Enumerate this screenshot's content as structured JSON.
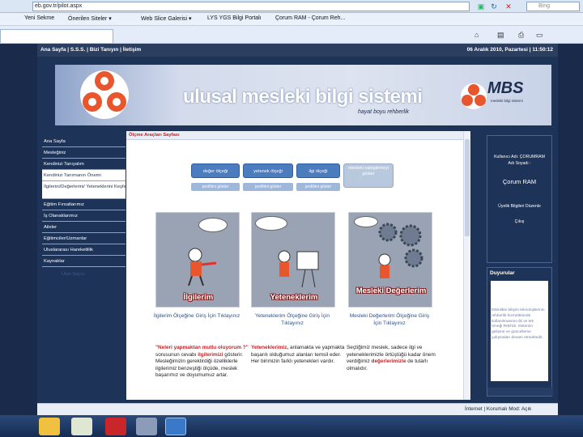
{
  "browser": {
    "url": "eb.gov.tr/pilot.aspx",
    "search_placeholder": "Bing",
    "favorites": [
      "Yeni Sekme",
      "Önerilen Siteler ▾",
      "Web Slice Galerisi ▾",
      "LYS YGS Bilgi Portalı",
      "Çorum RAM - Çorum Reh..."
    ]
  },
  "header": {
    "links": "Ana Sayfa | S.S.S. | Bizi Tanıyın | İletişim",
    "date": "06 Aralık 2010, Pazartesi | 11:50:12"
  },
  "banner": {
    "title": "ulusal mesleki bilgi sistemi",
    "subtitle": "hayat boyu rehberlik",
    "logo_text": "MBS",
    "logo_sub": "mesleki bilgi sistemi"
  },
  "nav": {
    "items": [
      "Ana Sayfa",
      "Mesleğiniz",
      "Kendinizi Tanıyalım",
      "Kendinizi Tanımanın Önemi",
      "İlgilerini/Değerlerini/ Yeteneklerini Keşfet",
      "Eğitim Fırsatlarımız",
      "İş Olanaklarımız",
      "Aileler",
      "Eğitimciler/Uzmanlar",
      "Uluslararası Hareketlilik",
      "Kaynaklar"
    ],
    "counter": "Ürün Sayısı"
  },
  "main": {
    "title": "Ölçme Araçları Sayfası",
    "buttons": [
      "değer ölçeği",
      "yetenek ölçeği",
      "ilgi ölçeği",
      "mesleki eşleştirmeyi göster"
    ],
    "small_buttons": [
      "profilimi göster",
      "profilimi göster",
      "profilimi göster"
    ],
    "cards": [
      {
        "label": "İlgilerim",
        "link": "İlgilerim Ölçeğine Giriş İçin Tıklayınız"
      },
      {
        "label": "Yeteneklerim",
        "link": "Yeteneklerim Ölçeğine Giriş İçin Tıklayınız"
      },
      {
        "label": "Mesleki Değerlerim",
        "link": "Mesleki Değerlerim Ölçeğine Giriş İçin Tıklayınız"
      }
    ],
    "desc1_a": "\"Neleri yapmaktan mutlu oluyorum ?\"",
    "desc1_b": " sorusunun cevabı ",
    "desc1_c": "ilgilerimizi",
    "desc1_d": " gösterir. Mesleğimizin gerektirdiği özelliklerle ilgilerimiz benzeştiği ölçüde, meslek başarımız ve doyumumuz artar.",
    "desc2_a": "Yeteneklerimiz,",
    "desc2_b": " anlamakta ve yapmakta başarılı olduğumuz alanları temsil eder. Her birimizin farklı yetenekleri vardır.",
    "desc3_a": "Seçtiğimiz meslek, sadece ilgi ve yeteneklerimizle örtüştüğü kadar önem verdiğimiz ",
    "desc3_b": "değerlerimizle",
    "desc3_c": " de tutarlı olmalıdır."
  },
  "user": {
    "line1": "Kullanıcı Adı: ÇORUMRAM",
    "line2": "Adı Soyadı :",
    "name": "Çorum RAM",
    "link1": "Üyelik Bilgileri Düzenle",
    "link2": "Çıkış"
  },
  "announcements": {
    "title": "Duyurular",
    "text": "Etkinlikte bilişim teknolojilerinin rehberlik hizmetlerinde kullanılmasının ilk ve tek örneği RIBİ'dir. Sistemin gelişme ve güncelleme çalışmaları devam etmektedir."
  },
  "status": {
    "zone": "İnternet | Korumalı Mod: Açık"
  }
}
